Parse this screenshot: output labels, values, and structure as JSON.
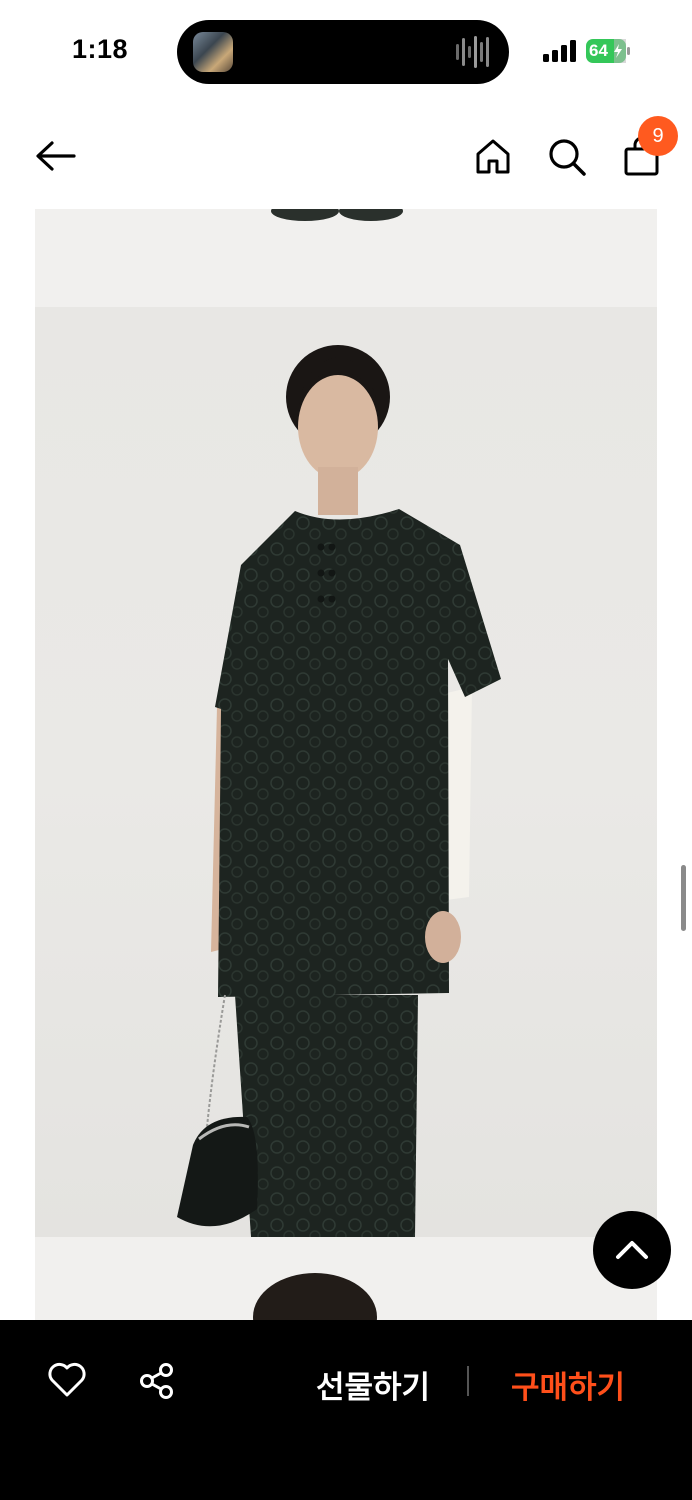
{
  "status_bar": {
    "time": "1:18",
    "battery_level": "64",
    "battery_charging": true,
    "signal_bars": 4,
    "live_activity": "now-playing"
  },
  "nav": {
    "back_icon": "arrow-left-icon",
    "home_icon": "home-icon",
    "search_icon": "search-icon",
    "cart_icon": "shopping-bag-icon",
    "cart_count": "9",
    "badge_color": "#ff5a1f"
  },
  "product_gallery": {
    "images": [
      "product-photo-shoes",
      "product-photo-model-black-jacquard-top",
      "product-photo-model-head"
    ]
  },
  "scroll_top_icon": "chevron-up-icon",
  "bottom_bar": {
    "like_icon": "heart-icon",
    "share_icon": "share-icon",
    "gift_label": "선물하기",
    "buy_label": "구매하기",
    "buy_color": "#ff4f1a"
  }
}
